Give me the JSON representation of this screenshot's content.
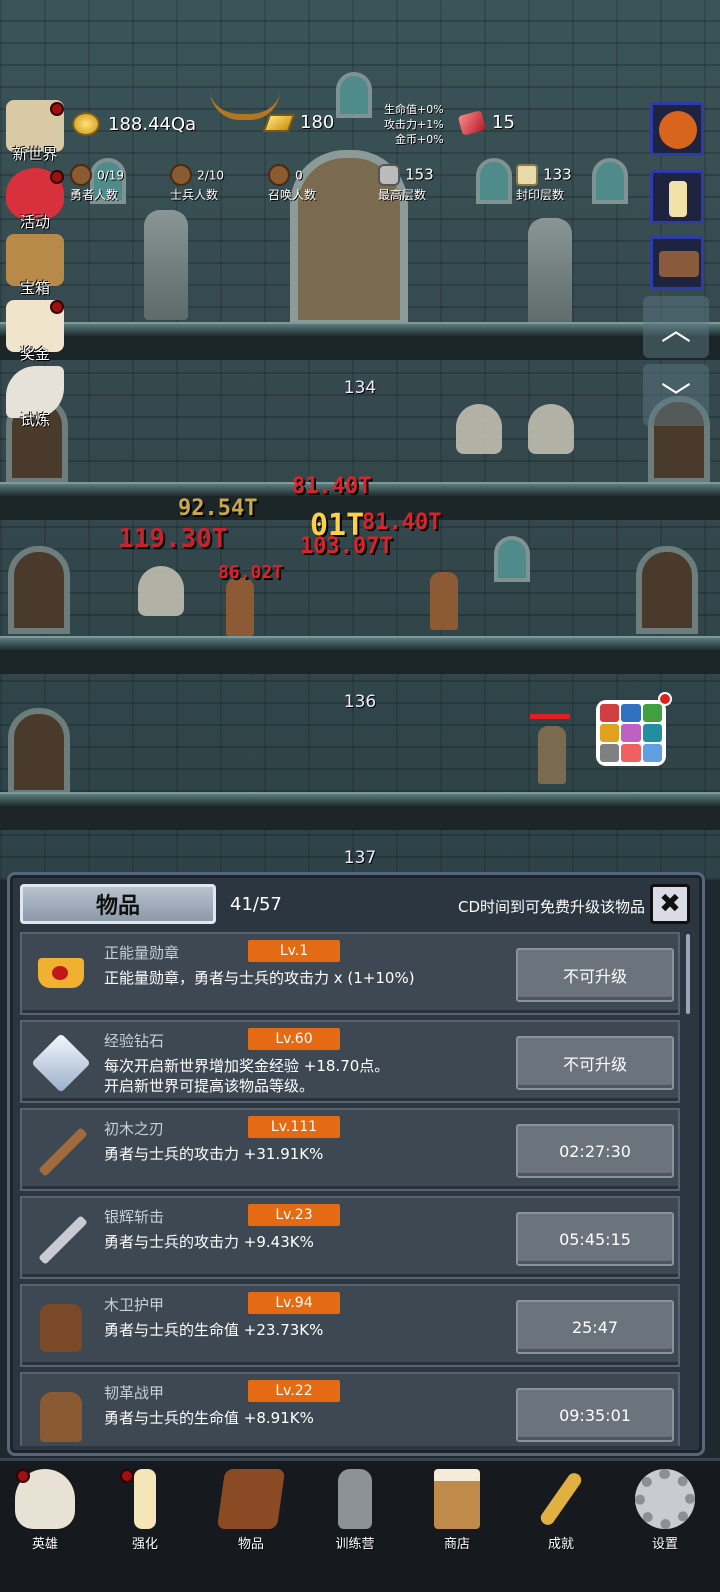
{
  "hud": {
    "gold": "188.44Qa",
    "gold_bar": "180",
    "gem": "15",
    "bonus_lines": [
      "生命值+0%",
      "攻击力+1%",
      "金币+0%"
    ],
    "stats": [
      {
        "value": "0/19",
        "label": "勇者人数"
      },
      {
        "value": "2/10",
        "label": "士兵人数"
      },
      {
        "value": "0",
        "label": "召唤人数"
      },
      {
        "value": "153",
        "label": "最高层数"
      },
      {
        "value": "133",
        "label": "封印层数"
      }
    ]
  },
  "left_menu": [
    {
      "label": "新世界",
      "icon": "map-scroll-icon",
      "dot": true
    },
    {
      "label": "活动",
      "icon": "heart-icon",
      "dot": true
    },
    {
      "label": "宝箱",
      "icon": "treasure-chest-icon",
      "dot": false
    },
    {
      "label": "奖金",
      "icon": "envelope-icon",
      "dot": true
    },
    {
      "label": "试炼",
      "icon": "feather-icon",
      "dot": false
    }
  ],
  "floors": {
    "f1": "134",
    "f3": "136",
    "f4": "137"
  },
  "damage": [
    "81.40T",
    "92.54T",
    "01T",
    "81.40T",
    "119.30T",
    "103.07T",
    "86.02T"
  ],
  "panel": {
    "tab": "物品",
    "count": "41/57",
    "note": "CD时间到可免费升级该物品",
    "close": "✖",
    "items": [
      {
        "name": "正能量勋章",
        "lv": "Lv.1",
        "desc": "正能量勋章，勇者与士兵的攻击力 x (1+10%)",
        "action": "不可升级",
        "icon": "crown-icon"
      },
      {
        "name": "经验钻石",
        "lv": "Lv.60",
        "desc": "每次开启新世界增加奖金经验 +18.70点。\n开启新世界可提高该物品等级。",
        "action": "不可升级",
        "icon": "diamond-icon"
      },
      {
        "name": "初木之刃",
        "lv": "Lv.111",
        "desc": "勇者与士兵的攻击力 +31.91K%",
        "action": "02:27:30",
        "icon": "wooden-sword-icon"
      },
      {
        "name": "银辉斩击",
        "lv": "Lv.23",
        "desc": "勇者与士兵的攻击力 +9.43K%",
        "action": "05:45:15",
        "icon": "silver-sword-icon"
      },
      {
        "name": "木卫护甲",
        "lv": "Lv.94",
        "desc": "勇者与士兵的生命值 +23.73K%",
        "action": "25:47",
        "icon": "armor-icon"
      },
      {
        "name": "韧革战甲",
        "lv": "Lv.22",
        "desc": "勇者与士兵的生命值 +8.91K%",
        "action": "09:35:01",
        "icon": "leather-armor-icon"
      }
    ]
  },
  "bottom_nav": [
    {
      "label": "英雄",
      "icon": "skull-icon",
      "dot": true
    },
    {
      "label": "强化",
      "icon": "candle-icon",
      "dot": true
    },
    {
      "label": "物品",
      "icon": "book-icon",
      "dot": false
    },
    {
      "label": "训练营",
      "icon": "lantern-icon",
      "dot": false
    },
    {
      "label": "商店",
      "icon": "beer-mug-icon",
      "dot": false
    },
    {
      "label": "成就",
      "icon": "key-icon",
      "dot": false
    },
    {
      "label": "设置",
      "icon": "gear-icon",
      "dot": false
    }
  ],
  "colors": {
    "level_badge": "#e56a14",
    "panel_bg": "#2c3640",
    "damage_red": "#e0202a",
    "damage_gold": "#ffd040"
  }
}
